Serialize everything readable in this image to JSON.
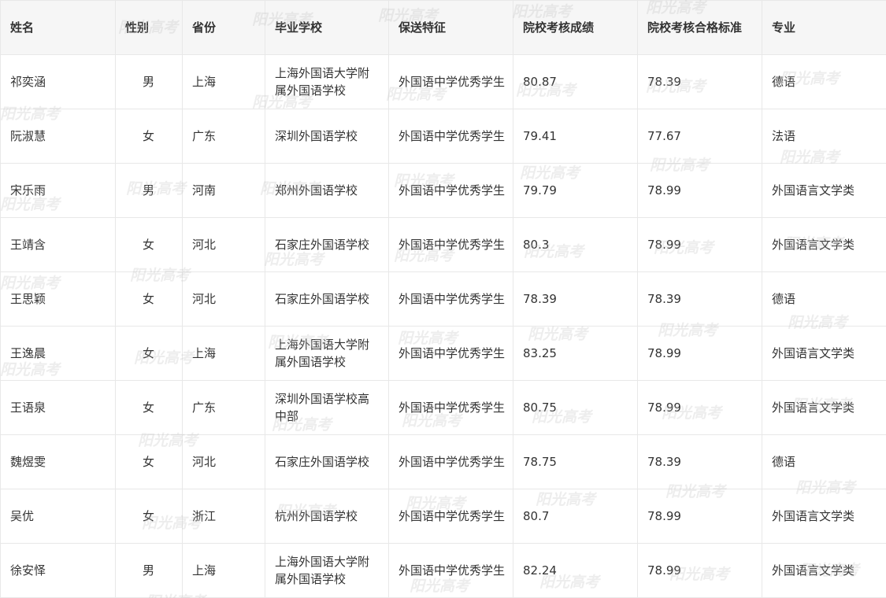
{
  "header": {
    "name": "姓名",
    "gender": "性别",
    "province": "省份",
    "school": "毕业学校",
    "feature": "保送特征",
    "score": "院校考核成绩",
    "pass_standard": "院校考核合格标准",
    "major": "专业"
  },
  "rows": [
    {
      "name": "祁奕涵",
      "gender": "男",
      "province": "上海",
      "school": "上海外国语大学附属外国语学校",
      "feature": "外国语中学优秀学生",
      "score": "80.87",
      "pass_standard": "78.39",
      "major": "德语"
    },
    {
      "name": "阮淑慧",
      "gender": "女",
      "province": "广东",
      "school": "深圳外国语学校",
      "feature": "外国语中学优秀学生",
      "score": "79.41",
      "pass_standard": "77.67",
      "major": "法语"
    },
    {
      "name": "宋乐雨",
      "gender": "男",
      "province": "河南",
      "school": "郑州外国语学校",
      "feature": "外国语中学优秀学生",
      "score": "79.79",
      "pass_standard": "78.99",
      "major": "外国语言文学类"
    },
    {
      "name": "王靖含",
      "gender": "女",
      "province": "河北",
      "school": "石家庄外国语学校",
      "feature": "外国语中学优秀学生",
      "score": "80.3",
      "pass_standard": "78.99",
      "major": "外国语言文学类"
    },
    {
      "name": "王思颖",
      "gender": "女",
      "province": "河北",
      "school": "石家庄外国语学校",
      "feature": "外国语中学优秀学生",
      "score": "78.39",
      "pass_standard": "78.39",
      "major": "德语"
    },
    {
      "name": "王逸晨",
      "gender": "女",
      "province": "上海",
      "school": "上海外国语大学附属外国语学校",
      "feature": "外国语中学优秀学生",
      "score": "83.25",
      "pass_standard": "78.99",
      "major": "外国语言文学类"
    },
    {
      "name": "王语泉",
      "gender": "女",
      "province": "广东",
      "school": "深圳外国语学校高中部",
      "feature": "外国语中学优秀学生",
      "score": "80.75",
      "pass_standard": "78.99",
      "major": "外国语言文学类"
    },
    {
      "name": "魏煜雯",
      "gender": "女",
      "province": "河北",
      "school": "石家庄外国语学校",
      "feature": "外国语中学优秀学生",
      "score": "78.75",
      "pass_standard": "78.39",
      "major": "德语"
    },
    {
      "name": "吴优",
      "gender": "女",
      "province": "浙江",
      "school": "杭州外国语学校",
      "feature": "外国语中学优秀学生",
      "score": "80.7",
      "pass_standard": "78.99",
      "major": "外国语言文学类"
    },
    {
      "name": "徐安怿",
      "gender": "男",
      "province": "上海",
      "school": "上海外国语大学附属外国语学校",
      "feature": "外国语中学优秀学生",
      "score": "82.24",
      "pass_standard": "78.99",
      "major": "外国语言文学类"
    }
  ],
  "watermark": "阳光高考"
}
